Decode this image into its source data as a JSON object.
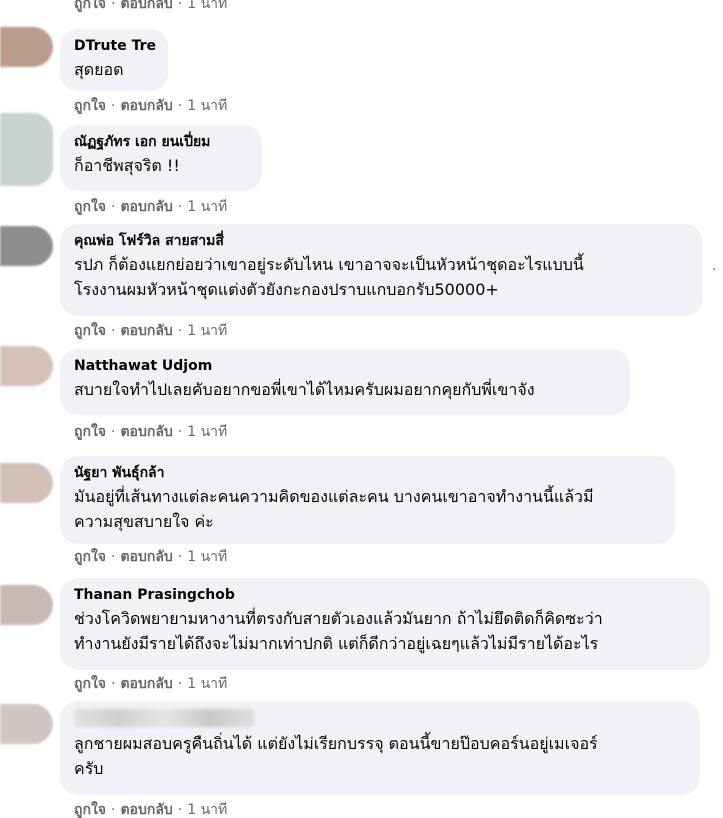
{
  "actions": {
    "like": "ถูกใจ",
    "reply": "ตอบกลับ",
    "separator": "·"
  },
  "comments": [
    {
      "author": "",
      "lines": [],
      "time": "1 นาที",
      "avatar_color": "#c9b3a6"
    },
    {
      "author": "DTrute Tre",
      "lines": [
        "สุดยอด"
      ],
      "time": "1 นาที",
      "avatar_color": "#b99c8c"
    },
    {
      "author": "ณัฏฐภัทร เอก ยนเปี่ยม",
      "lines": [
        "ก็อาชีพสุจริต !!"
      ],
      "time": "1 นาที",
      "avatar_color": "#c8d2d0"
    },
    {
      "author": "คุณพ่อ โฟร์วิล สายสามสี่",
      "lines": [
        "รปภ ก็ต้องแยกย่อยว่าเขาอยู่ระดับไหน เขาอาจจะเป็นหัวหน้าชุดอะไรแบบนี้",
        "โรงงานผมหัวหน้าชุดแต่งตัวยังกะกองปราบแกบอกรับ50000+"
      ],
      "time": "1 นาที",
      "avatar_color": "#8d8d8f"
    },
    {
      "author": "Natthawat Udjom",
      "lines": [
        "สบายใจทำไปเลยคับอยากขอพี่เขาได้ไหมครับผมอยากคุยกับพี่เขาจัง"
      ],
      "time": "1 นาที",
      "avatar_color": "#d6c1b8"
    },
    {
      "author": "นัฐยา พันธุ์กล้า",
      "lines": [
        "มันอยู่ที่เส้นทางแต่ละคนความคิดของแต่ละคน บางคนเขาอาจทำงานนี้แล้วมี",
        "ความสุขสบายใจ ค่ะ"
      ],
      "time": "1 นาที",
      "avatar_color": "#d2bfb6"
    },
    {
      "author": "Thanan Prasingchob",
      "lines": [
        "ช่วงโควิดพยายามหางานที่ตรงกับสายตัวเองแล้วมันยาก ถ้าไม่ยึดติดก็คิดซะว่า",
        "ทำงานยังมีรายได้ถึงจะไม่มากเท่าปกติ แต่ก็ดีกว่าอยู่เฉยๆแล้วไม่มีรายได้อะไร"
      ],
      "time": "1 นาที",
      "avatar_color": "#c9b9b4"
    },
    {
      "author": "",
      "lines": [
        "ลูกชายผมสอบครูคืนถิ่นได้ แต่ยังไม่เรียกบรรจุ ตอนนี้ขายป๊อบคอร์นอยู่เมเจอร์",
        "ครับ"
      ],
      "time": "1 นาที",
      "avatar_color": "#cfc5c2"
    }
  ],
  "more_icon": "more-dots-icon"
}
